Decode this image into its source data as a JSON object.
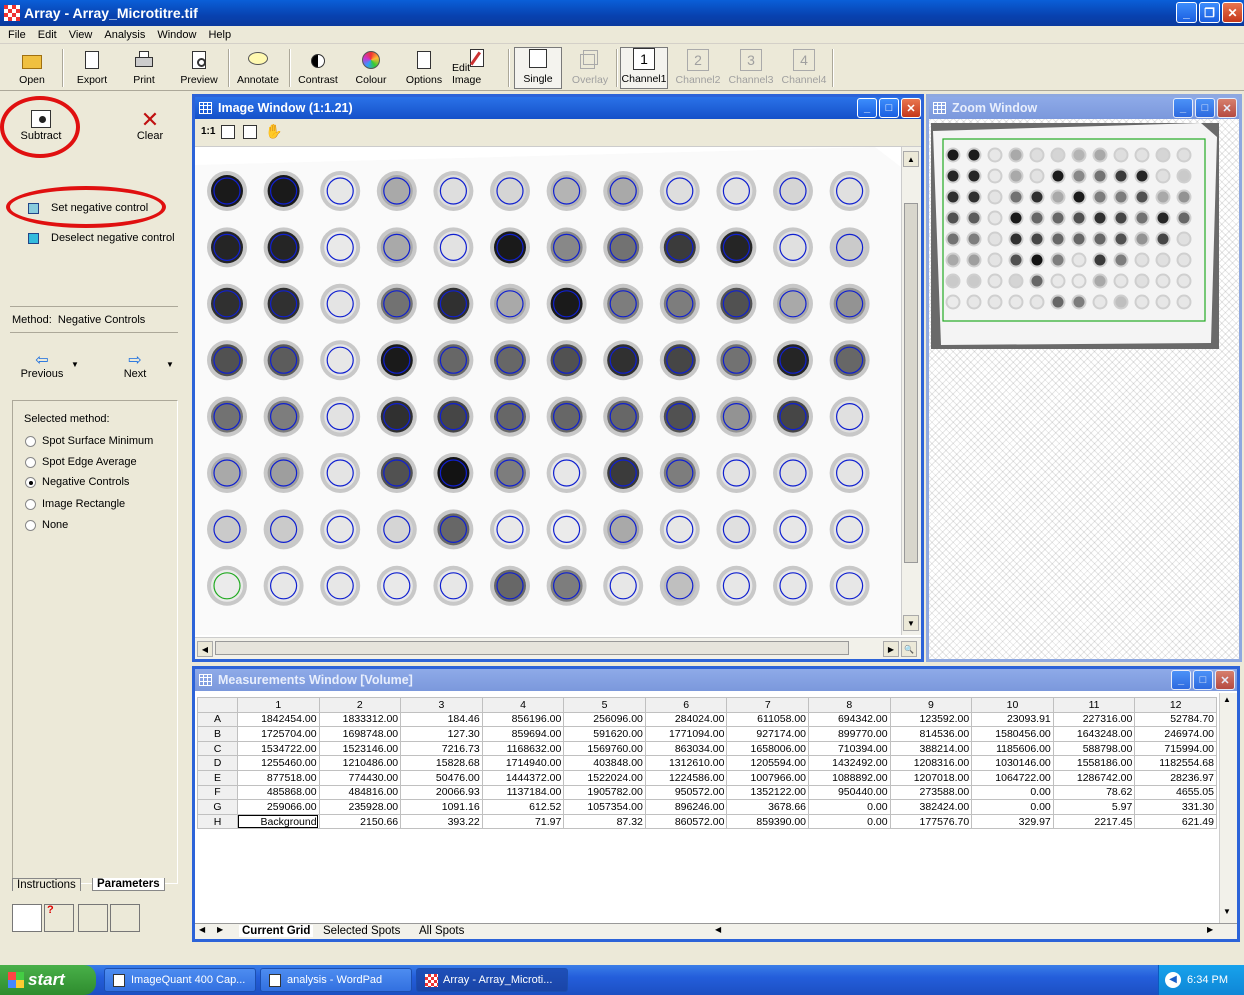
{
  "window": {
    "title": "Array - Array_Microtitre.tif"
  },
  "menu": [
    "File",
    "Edit",
    "View",
    "Analysis",
    "Window",
    "Help"
  ],
  "toolbar": {
    "open": "Open",
    "export": "Export",
    "print": "Print",
    "preview": "Preview",
    "annotate": "Annotate",
    "contrast": "Contrast",
    "colour": "Colour",
    "options": "Options",
    "edit_image": "Edit Image",
    "single": "Single",
    "overlay": "Overlay",
    "channel1": "Channel1",
    "channel2": "Channel2",
    "channel3": "Channel3",
    "channel4": "Channel4",
    "ch1": "1",
    "ch2": "2",
    "ch3": "3",
    "ch4": "4"
  },
  "left": {
    "subtract": "Subtract",
    "clear": "Clear",
    "set_neg": "Set negative control",
    "deselect_neg": "Deselect negative control",
    "method_label": "Method:",
    "method_value": "Negative Controls",
    "previous": "Previous",
    "next": "Next",
    "selected_method": "Selected method:",
    "options": [
      "Spot Surface Minimum",
      "Spot Edge Average",
      "Negative Controls",
      "Image Rectangle",
      "None"
    ],
    "selected_index": 2,
    "tab_instructions": "Instructions",
    "tab_parameters": "Parameters"
  },
  "image_window": {
    "title": "Image Window (1:1.21)",
    "zoom_label": "1:1"
  },
  "zoom_window": {
    "title": "Zoom Window"
  },
  "wells": [
    [
      0.95,
      0.95,
      0.02,
      0.3,
      0.06,
      0.1,
      0.25,
      0.3,
      0.06,
      0.04,
      0.1,
      0.05
    ],
    [
      0.9,
      0.9,
      0.01,
      0.3,
      0.04,
      0.95,
      0.45,
      0.55,
      0.8,
      0.9,
      0.05,
      0.15
    ],
    [
      0.85,
      0.85,
      0.03,
      0.55,
      0.85,
      0.3,
      0.95,
      0.5,
      0.5,
      0.7,
      0.3,
      0.4
    ],
    [
      0.7,
      0.65,
      0.02,
      0.95,
      0.6,
      0.6,
      0.7,
      0.85,
      0.75,
      0.55,
      0.9,
      0.6
    ],
    [
      0.55,
      0.5,
      0.04,
      0.85,
      0.75,
      0.6,
      0.6,
      0.6,
      0.7,
      0.4,
      0.75,
      0.05
    ],
    [
      0.3,
      0.35,
      0.03,
      0.7,
      0.98,
      0.5,
      0.02,
      0.8,
      0.5,
      0.04,
      0.05,
      0.03
    ],
    [
      0.15,
      0.15,
      0.02,
      0.1,
      0.6,
      0.01,
      0.0,
      0.3,
      0.02,
      0.05,
      0.02,
      0.02
    ],
    [
      0.0,
      0.02,
      0.02,
      0.01,
      0.02,
      0.6,
      0.5,
      0.02,
      0.2,
      0.02,
      0.02,
      0.02
    ]
  ],
  "measurements": {
    "title": "Measurements Window [Volume]",
    "columns": [
      "1",
      "2",
      "3",
      "4",
      "5",
      "6",
      "7",
      "8",
      "9",
      "10",
      "11",
      "12"
    ],
    "rows": [
      {
        "label": "A",
        "values": [
          "1842454.00",
          "1833312.00",
          "184.46",
          "856196.00",
          "256096.00",
          "284024.00",
          "611058.00",
          "694342.00",
          "123592.00",
          "23093.91",
          "227316.00",
          "52784.70"
        ]
      },
      {
        "label": "B",
        "values": [
          "1725704.00",
          "1698748.00",
          "127.30",
          "859694.00",
          "591620.00",
          "1771094.00",
          "927174.00",
          "899770.00",
          "814536.00",
          "1580456.00",
          "1643248.00",
          "246974.00"
        ]
      },
      {
        "label": "C",
        "values": [
          "1534722.00",
          "1523146.00",
          "7216.73",
          "1168632.00",
          "1569760.00",
          "863034.00",
          "1658006.00",
          "710394.00",
          "388214.00",
          "1185606.00",
          "588798.00",
          "715994.00"
        ]
      },
      {
        "label": "D",
        "values": [
          "1255460.00",
          "1210486.00",
          "15828.68",
          "1714940.00",
          "403848.00",
          "1312610.00",
          "1205594.00",
          "1432492.00",
          "1208316.00",
          "1030146.00",
          "1558186.00",
          "1182554.68"
        ]
      },
      {
        "label": "E",
        "values": [
          "877518.00",
          "774430.00",
          "50476.00",
          "1444372.00",
          "1522024.00",
          "1224586.00",
          "1007966.00",
          "1088892.00",
          "1207018.00",
          "1064722.00",
          "1286742.00",
          "28236.97"
        ]
      },
      {
        "label": "F",
        "values": [
          "485868.00",
          "484816.00",
          "20066.93",
          "1137184.00",
          "1905782.00",
          "950572.00",
          "1352122.00",
          "950440.00",
          "273588.00",
          "0.00",
          "78.62",
          "4655.05"
        ]
      },
      {
        "label": "G",
        "values": [
          "259066.00",
          "235928.00",
          "1091.16",
          "612.52",
          "1057354.00",
          "896246.00",
          "3678.66",
          "0.00",
          "382424.00",
          "0.00",
          "5.97",
          "331.30"
        ]
      },
      {
        "label": "H",
        "values": [
          "Background",
          "2150.66",
          "393.22",
          "71.97",
          "87.32",
          "860572.00",
          "859390.00",
          "0.00",
          "177576.70",
          "329.97",
          "2217.45",
          "621.49"
        ]
      }
    ],
    "tabs": [
      "Current Grid",
      "Selected Spots",
      "All Spots"
    ]
  },
  "taskbar": {
    "start": "start",
    "tasks": [
      "ImageQuant 400 Cap...",
      "analysis - WordPad",
      "Array - Array_Microti..."
    ],
    "clock": "6:34 PM"
  }
}
